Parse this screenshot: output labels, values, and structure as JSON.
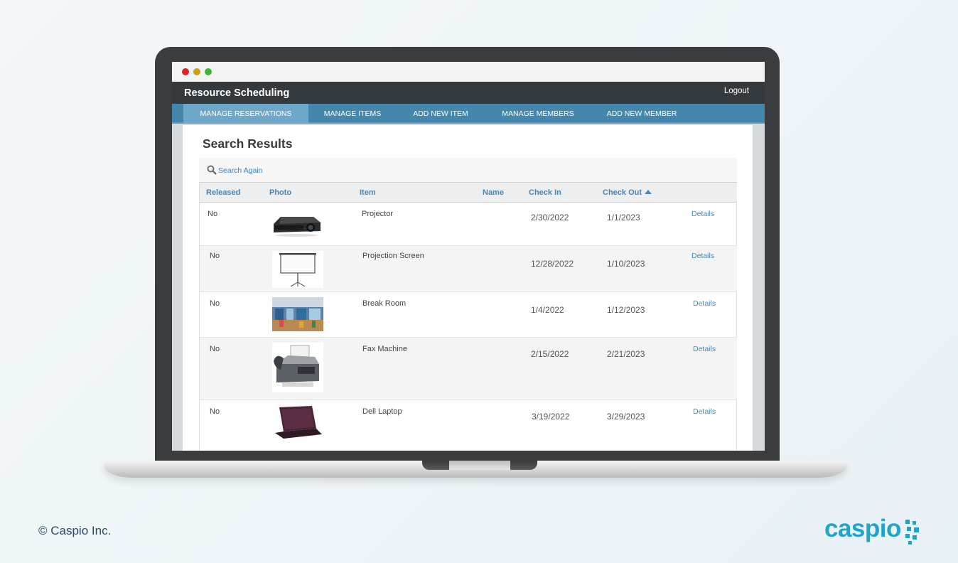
{
  "app": {
    "title": "Resource Scheduling",
    "logout_label": "Logout"
  },
  "nav": {
    "items": [
      {
        "label": "MANAGE RESERVATIONS",
        "active": true
      },
      {
        "label": "MANAGE ITEMS",
        "active": false
      },
      {
        "label": "ADD NEW ITEM",
        "active": false
      },
      {
        "label": "MANAGE MEMBERS",
        "active": false
      },
      {
        "label": "ADD NEW MEMBER",
        "active": false
      }
    ]
  },
  "page": {
    "title": "Search Results",
    "search_again_label": "Search Again"
  },
  "table": {
    "columns": [
      "Released",
      "Photo",
      "Item",
      "Name",
      "Check In",
      "Check Out"
    ],
    "sorted_column": "Check Out",
    "sort_direction": "ascending",
    "rows": [
      {
        "released": "No",
        "photo": "projector-image",
        "item": "Projector",
        "name": "",
        "check_in": "2/30/2022",
        "check_out": "1/1/2023",
        "details": "Details"
      },
      {
        "released": "No",
        "photo": "projection-screen-image",
        "item": "Projection Screen",
        "name": "",
        "check_in": "12/28/2022",
        "check_out": "1/10/2023",
        "details": "Details"
      },
      {
        "released": "No",
        "photo": "break-room-image",
        "item": "Break Room",
        "name": "",
        "check_in": "1/4/2022",
        "check_out": "1/12/2023",
        "details": "Details"
      },
      {
        "released": "No",
        "photo": "fax-machine-image",
        "item": "Fax Machine",
        "name": "",
        "check_in": "2/15/2022",
        "check_out": "2/21/2023",
        "details": "Details"
      },
      {
        "released": "No",
        "photo": "laptop-image",
        "item": "Dell Laptop",
        "name": "",
        "check_in": "3/19/2022",
        "check_out": "3/29/2023",
        "details": "Details"
      }
    ]
  },
  "footer": {
    "copyright": "© Caspio Inc.",
    "brand": "caspio"
  },
  "colors": {
    "nav_bar": "#4586ad",
    "nav_active": "#6fa7ca",
    "app_bar": "#34393d",
    "link": "#4a86b4",
    "brand": "#1ea5c9"
  }
}
